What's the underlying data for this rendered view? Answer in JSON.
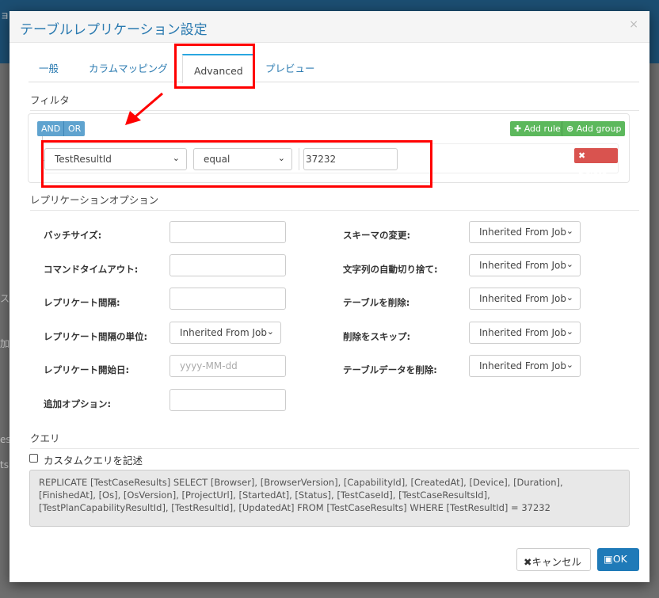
{
  "background": {
    "fragments": [
      "ョ",
      "ス",
      "加",
      "es",
      "ts"
    ]
  },
  "modal": {
    "title": "テーブルレプリケーション設定",
    "close": "×"
  },
  "tabs": [
    {
      "label": "一般"
    },
    {
      "label": "カラムマッピング"
    },
    {
      "label": "Advanced"
    },
    {
      "label": "プレビュー"
    }
  ],
  "filter": {
    "section": "フィルタ",
    "and": "AND",
    "or": "OR",
    "add_rule": "Add rule",
    "add_group": "Add group",
    "field": "TestResultId",
    "operator": "equal",
    "value": "37232",
    "delete": "Delete"
  },
  "options": {
    "section": "レプリケーションオプション",
    "left": [
      {
        "label": "バッチサイズ:",
        "value": ""
      },
      {
        "label": "コマンドタイムアウト:",
        "value": ""
      },
      {
        "label": "レプリケート間隔:",
        "value": ""
      },
      {
        "label": "レプリケート間隔の単位:",
        "value": "Inherited From Job"
      },
      {
        "label": "レプリケート開始日:",
        "placeholder": "yyyy-MM-dd"
      },
      {
        "label": "追加オプション:",
        "value": ""
      }
    ],
    "right": [
      {
        "label": "スキーマの変更:",
        "value": "Inherited From Job"
      },
      {
        "label": "文字列の自動切り捨て:",
        "value": "Inherited From Job"
      },
      {
        "label": "テーブルを削除:",
        "value": "Inherited From Job"
      },
      {
        "label": "削除をスキップ:",
        "value": "Inherited From Job"
      },
      {
        "label": "テーブルデータを削除:",
        "value": "Inherited From Job"
      }
    ]
  },
  "query": {
    "section": "クエリ",
    "custom_label": "カスタムクエリを記述",
    "text": "REPLICATE [TestCaseResults] SELECT [Browser], [BrowserVersion], [CapabilityId], [CreatedAt], [Device], [Duration], [FinishedAt], [Os], [OsVersion], [ProjectUrl], [StartedAt], [Status], [TestCaseId], [TestCaseResultsId], [TestPlanCapabilityResultId], [TestResultId], [UpdatedAt] FROM [TestCaseResults] WHERE [TestResultId] = 37232"
  },
  "footer": {
    "cancel": "キャンセル",
    "ok": "OK"
  },
  "colors": {
    "accent": "#2a7ab0",
    "ok": "#1f7ab8",
    "add": "#5cb85c",
    "delete": "#d9534f",
    "andor": "#5fa3cf"
  }
}
